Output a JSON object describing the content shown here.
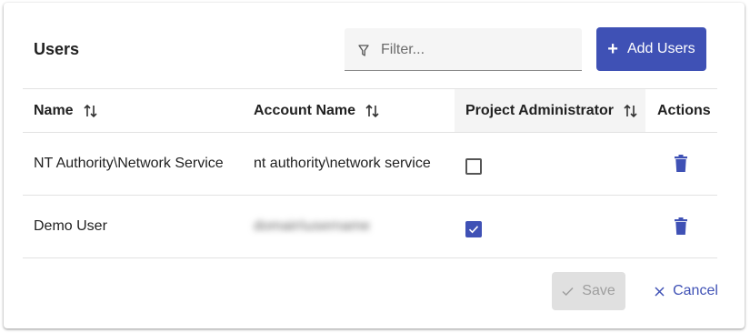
{
  "header": {
    "title": "Users",
    "filter_placeholder": "Filter...",
    "filter_value": "",
    "add_button_label": "Add Users"
  },
  "table": {
    "columns": [
      {
        "label": "Name",
        "sortable": true
      },
      {
        "label": "Account Name",
        "sortable": true
      },
      {
        "label": "Project Administrator",
        "sortable": true
      },
      {
        "label": "Actions",
        "sortable": false
      }
    ],
    "rows": [
      {
        "name": "NT Authority\\Network Service",
        "account_name": "nt authority\\network service",
        "project_administrator": false
      },
      {
        "name": "Demo User",
        "account_name": "domain\\username",
        "project_administrator": true
      }
    ]
  },
  "footer": {
    "save_label": "Save",
    "cancel_label": "Cancel"
  },
  "colors": {
    "primary": "#3f51b5",
    "disabled_bg": "#e0e0e0",
    "disabled_text": "#9e9e9e"
  },
  "icons": [
    "filter-icon",
    "plus-icon",
    "sort-icon",
    "trash-icon",
    "check-icon",
    "close-icon"
  ]
}
